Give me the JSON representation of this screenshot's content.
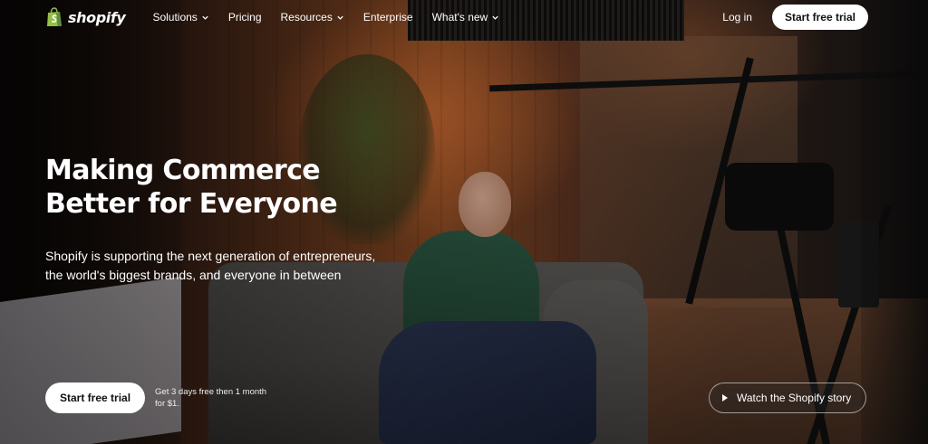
{
  "nav": {
    "logo_text": "shopify",
    "items": [
      {
        "label": "Solutions",
        "has_dropdown": true
      },
      {
        "label": "Pricing",
        "has_dropdown": false
      },
      {
        "label": "Resources",
        "has_dropdown": true
      },
      {
        "label": "Enterprise",
        "has_dropdown": false
      },
      {
        "label": "What's new",
        "has_dropdown": true
      }
    ],
    "login_label": "Log in",
    "cta_label": "Start free trial"
  },
  "hero": {
    "headline_line1": "Making Commerce",
    "headline_line2": "Better for Everyone",
    "subtext_line1": "Shopify is supporting the next generation of entrepreneurs,",
    "subtext_line2": "the world's biggest brands, and everyone in between",
    "cta_label": "Start free trial",
    "cta_note_line1": "Get 3 days free then 1 month",
    "cta_note_line2": "for $1.",
    "watch_label": "Watch the Shopify story"
  },
  "colors": {
    "brand_green": "#95bf47",
    "button_bg": "#ffffff",
    "button_text": "#111111"
  },
  "icons": {
    "logo": "shopify-bag-icon",
    "dropdown": "chevron-down-icon",
    "play": "play-icon"
  }
}
